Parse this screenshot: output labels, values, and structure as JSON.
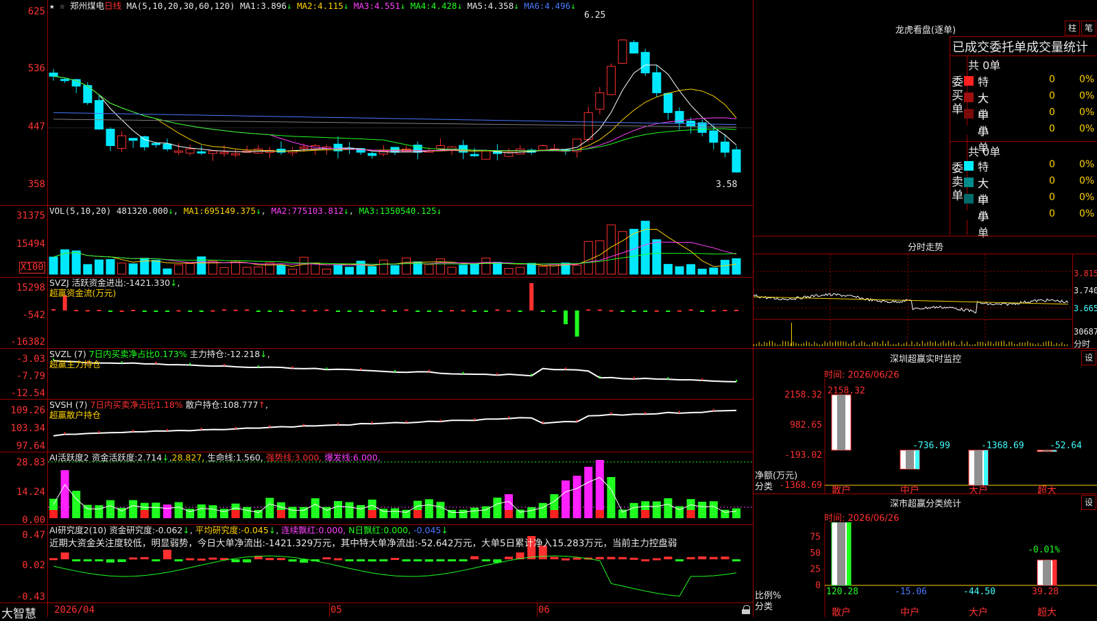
{
  "colors": {
    "up": "#ff3030",
    "down": "#00e8ff",
    "bg": "#000000",
    "divider": "#a00000",
    "ma1": "#ffffff",
    "ma2": "#ffd200",
    "ma3": "#ff40ff",
    "ma4": "#20ff20",
    "ma5": "#808080",
    "ma6": "#4a78ff"
  },
  "main": {
    "header_stars": "★ ☆",
    "stock_name": "郑州煤电",
    "period": "日线",
    "ma_label": "MA(5,10,20,30,60,120)",
    "ma1_label": "MA1:",
    "ma1": "3.896",
    "ma2_label": "MA2:",
    "ma2": "4.115",
    "ma3_label": "MA3:",
    "ma3": "4.551",
    "ma4_label": "MA4:",
    "ma4": "4.428",
    "ma5_label": "MA5:",
    "ma5": "4.358",
    "ma6_label": "MA6:",
    "ma6": "4.496",
    "arrow_down": "↓",
    "arrow_up": "↑",
    "high_label": "6.25",
    "low_label": "3.58",
    "y_labels": [
      "625",
      "536",
      "447",
      "358"
    ]
  },
  "vol": {
    "title": "VOL(5,10,20)",
    "value": "481320.000",
    "ma1_label": "MA1:",
    "ma1": "695149.375",
    "ma2_label": "MA2:",
    "ma2": "775103.812",
    "ma3_label": "MA3:",
    "ma3": "1350540.125",
    "y_labels": [
      "31375",
      "15494"
    ],
    "unit": "X100"
  },
  "svzj": {
    "title": "SVZJ",
    "label": "活跃资金进出:",
    "value": "-1421.330",
    "sub": "超赢资金流(万元)",
    "y_labels": [
      "15298",
      "-542",
      "-16382"
    ]
  },
  "svzl": {
    "title": "SVZL (7)",
    "ratio": "7日内买卖净占比0.173%",
    "label": "主力持仓:",
    "value": "-12.218",
    "sub": "超赢主力持仓",
    "y_labels": [
      "-3.03",
      "-7.79",
      "-12.54"
    ]
  },
  "svsh": {
    "title": "SVSH (7)",
    "ratio": "7日内买卖净占比1.18%",
    "label": "散户持仓:",
    "value": "108.777",
    "sub": "超赢散户持仓",
    "y_labels": [
      "109.26",
      "103.34",
      "97.64"
    ]
  },
  "ai1": {
    "title": "AI活跃度2",
    "l1": "资金活跃度:",
    "v1": "2.714",
    "v2": "28.827,",
    "l3": "生命线:",
    "v3": "1.560,",
    "l4": "强势线:",
    "v4": "3.000,",
    "l5": "爆发线:",
    "v5": "6.000,",
    "y_labels": [
      "28.83",
      "14.24",
      "0.00"
    ]
  },
  "ai2": {
    "title": "AI研究度2(10)",
    "l1": "资金研究度:",
    "v1": "-0.062",
    "l2": "平均研究度:",
    "v2": "-0.045",
    "l3": "连续飘红:",
    "v3": "0.000,",
    "l4": "N日飘红:",
    "v4": "0.000,",
    "v5": "-0.045",
    "comment": "近期大资金关注度较低，明显弱势，今日大单净流出:-1421.329万元，其中特大单净流出:-52.642万元，大单5日累计净入15.283万元，当前主力控盘弱",
    "y_labels": [
      "0.47",
      "0.02",
      "-0.43"
    ]
  },
  "xaxis": {
    "brand": "大智慧",
    "d1": "2026/04",
    "d2": "05",
    "d3": "06"
  },
  "dragon": {
    "title": "龙虎看盘(逐单)",
    "btn1": "柱",
    "btn2": "笔",
    "header": "已成交委托单成交量统计",
    "buy_side": "委买单",
    "sell_side": "委卖单",
    "buy_total": "共 0单",
    "sell_total": "共 0单",
    "buy_rows": [
      {
        "name": "特大",
        "v": "0",
        "p": "0%",
        "color": "#ff2020"
      },
      {
        "name": "大单",
        "v": "0",
        "p": "0%",
        "color": "#a01010"
      },
      {
        "name": "中单",
        "v": "0",
        "p": "0%",
        "color": "#7a0a0a"
      },
      {
        "name": "小单",
        "v": "0",
        "p": "0%",
        "color": "#000000"
      }
    ],
    "sell_rows": [
      {
        "name": "特大",
        "v": "0",
        "p": "0%",
        "color": "#00f0ff"
      },
      {
        "name": "大单",
        "v": "0",
        "p": "0%",
        "color": "#008c8c"
      },
      {
        "name": "中单",
        "v": "0",
        "p": "0%",
        "color": "#006a6a"
      },
      {
        "name": "小单",
        "v": "0",
        "p": "0%",
        "color": "#000000"
      }
    ]
  },
  "minute": {
    "title": "分时走势",
    "y1": "3.815",
    "y2": "3.740",
    "y3": "3.665",
    "vol": "30687",
    "unit": "分时"
  },
  "realtime": {
    "title": "深圳超赢实时监控",
    "btn": "设",
    "time_label": "时间:",
    "date": "2026/06/26",
    "y_labels": [
      "2158.32",
      "982.65",
      "-193.02",
      "-1368.69"
    ],
    "unit1": "净额(万元)",
    "unit2": "分类",
    "bars": [
      {
        "label": "散户",
        "value": 2158.32,
        "text": "2158.32"
      },
      {
        "label": "中户",
        "value": -736.99,
        "text": "-736.99"
      },
      {
        "label": "大户",
        "value": -1368.69,
        "text": "-1368.69"
      },
      {
        "label": "超大",
        "value": -52.64,
        "text": "-52.64"
      }
    ]
  },
  "classify": {
    "title": "深市超赢分类统计",
    "btn": "设",
    "time_label": "时间:",
    "date": "2026/06/26",
    "y_labels": [
      "75",
      "50",
      "25",
      "0"
    ],
    "unit1": "比例%",
    "unit2": "分类",
    "top_value": "-0.01%",
    "bars": [
      {
        "label": "散户",
        "value": 120.28,
        "text": "120.28",
        "color": "#20ff20"
      },
      {
        "label": "中户",
        "value": -15.06,
        "text": "-15.06",
        "color": "#4a78ff"
      },
      {
        "label": "大户",
        "value": -44.5,
        "text": "-44.50",
        "color": "#40ffff"
      },
      {
        "label": "超大",
        "value": 39.28,
        "text": "39.28",
        "color": "#ff3030"
      }
    ]
  }
}
